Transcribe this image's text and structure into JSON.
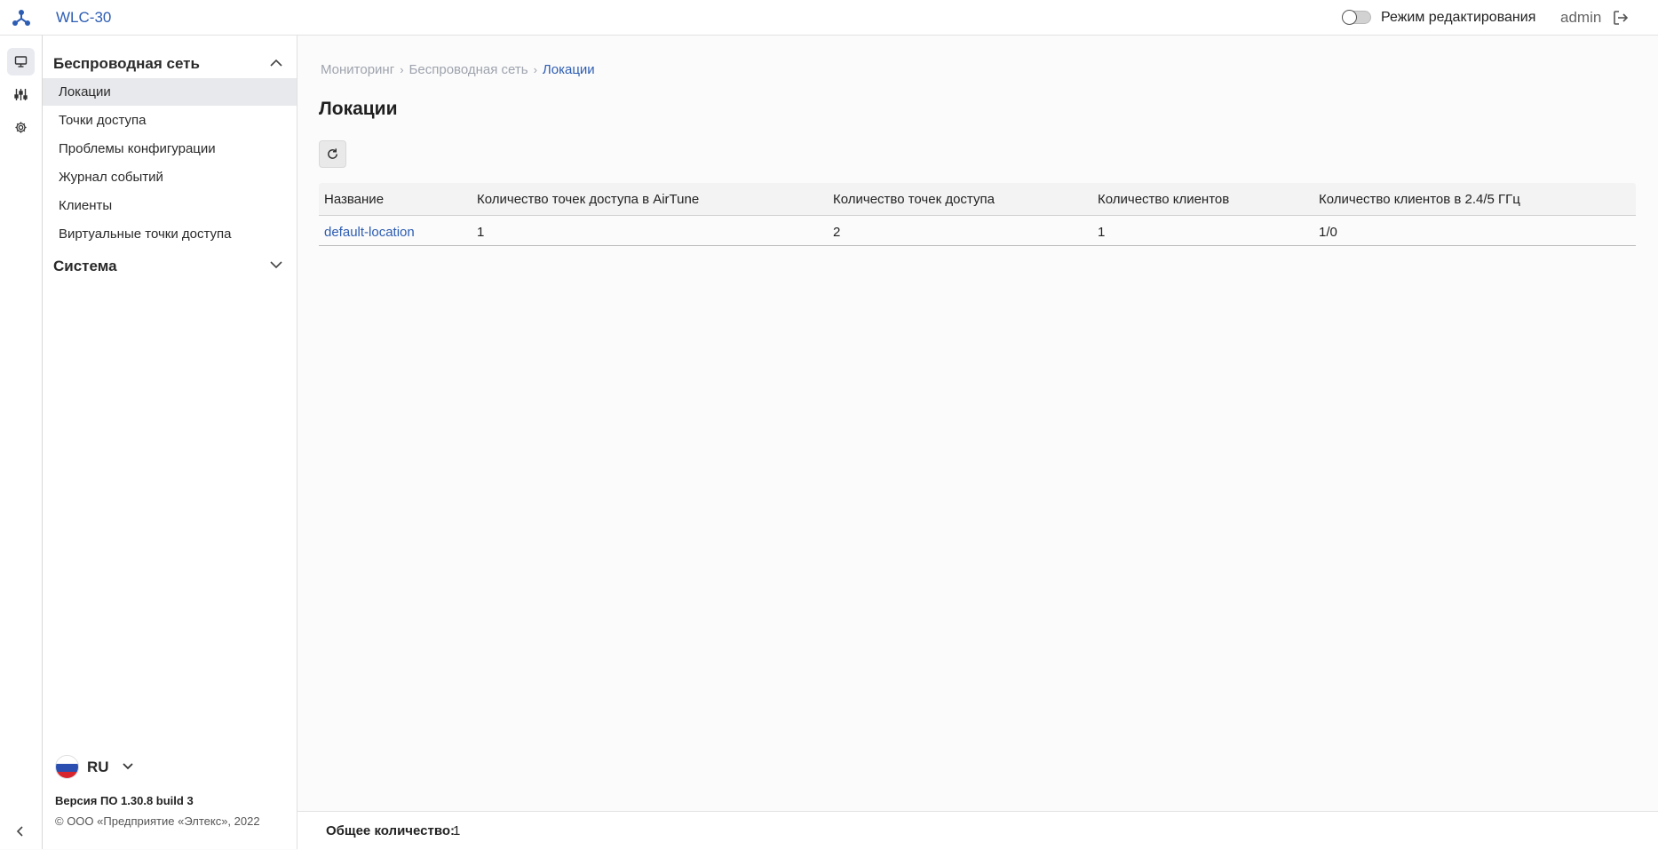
{
  "header": {
    "app_title": "WLC-30",
    "edit_mode_label": "Режим редактирования",
    "edit_mode_on": false,
    "user": "admin"
  },
  "rail": {
    "items": [
      {
        "icon": "monitor-icon",
        "active": true
      },
      {
        "icon": "sliders-icon",
        "active": false
      },
      {
        "icon": "gear-icon",
        "active": false
      }
    ]
  },
  "sidebar": {
    "sections": [
      {
        "title": "Беспроводная сеть",
        "expanded": true,
        "items": [
          {
            "label": "Локации",
            "active": true
          },
          {
            "label": "Точки доступа"
          },
          {
            "label": "Проблемы конфигурации"
          },
          {
            "label": "Журнал событий"
          },
          {
            "label": "Клиенты"
          },
          {
            "label": "Виртуальные точки доступа"
          }
        ]
      },
      {
        "title": "Система",
        "expanded": false
      }
    ],
    "language": "RU",
    "version": "Версия ПО 1.30.8 build 3",
    "copyright": "© ООО «Предприятие «Элтекс», 2022"
  },
  "breadcrumb": [
    "Мониторинг",
    "Беспроводная сеть",
    "Локации"
  ],
  "page_title": "Локации",
  "table": {
    "columns": [
      "Название",
      "Количество точек доступа в AirTune",
      "Количество точек доступа",
      "Количество клиентов",
      "Количество клиентов в 2.4/5 ГГц"
    ],
    "rows": [
      [
        "default-location",
        "1",
        "2",
        "1",
        "1/0"
      ]
    ]
  },
  "footer": {
    "total_label": "Общее количество:",
    "total_value": "1"
  },
  "colors": {
    "accent": "#2d5db3",
    "active_bg": "#e8e9ec"
  }
}
